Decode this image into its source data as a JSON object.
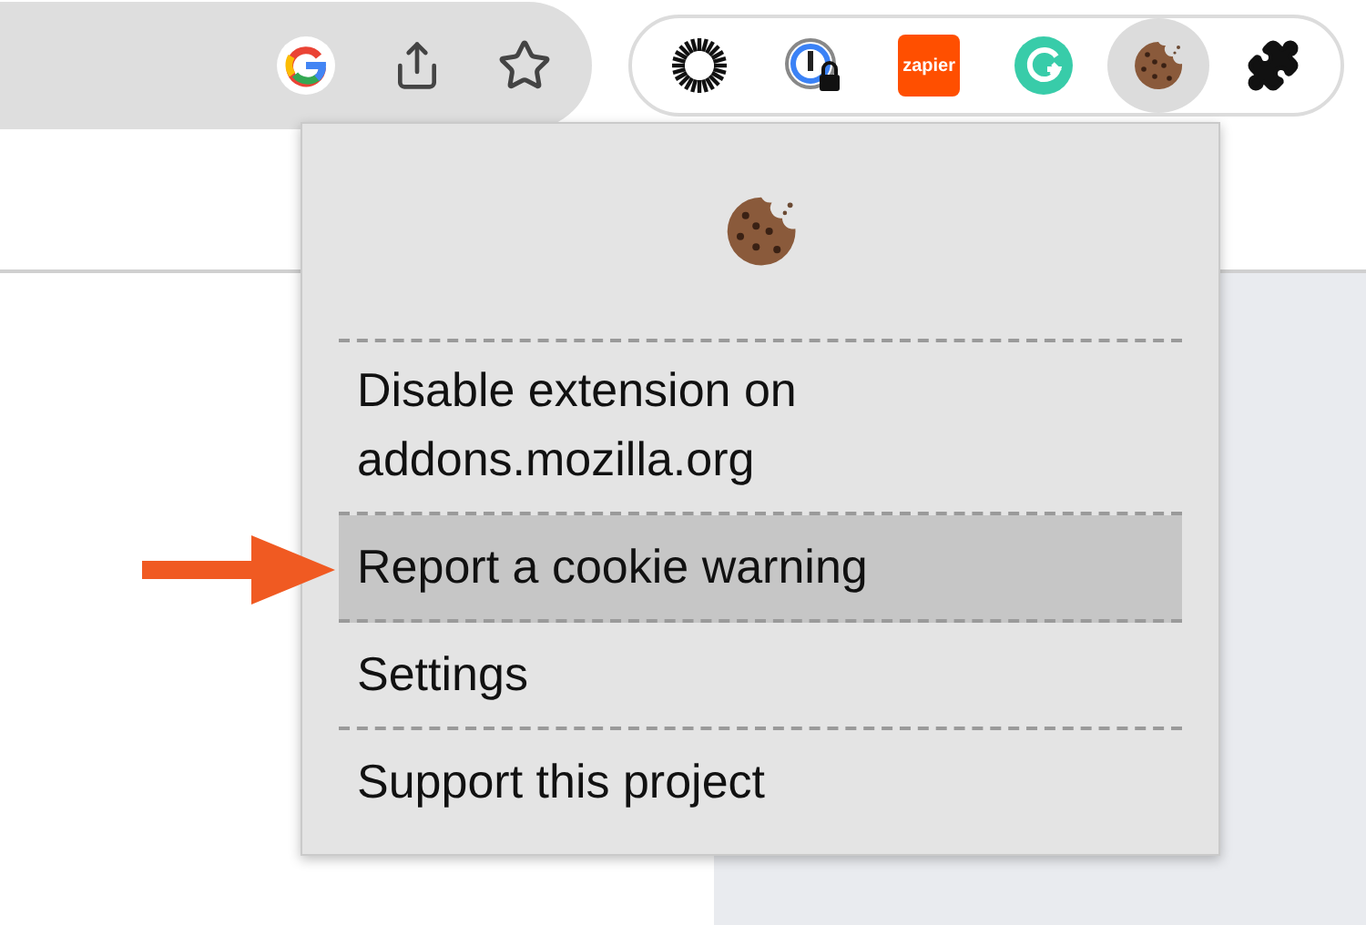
{
  "toolbar": {
    "actions": [
      {
        "kind": "google"
      },
      {
        "kind": "share"
      },
      {
        "kind": "bookmark"
      }
    ]
  },
  "extensions": [
    {
      "kind": "sunburst",
      "selected": false
    },
    {
      "kind": "password",
      "selected": false
    },
    {
      "kind": "zapier",
      "label": "zapier",
      "selected": false
    },
    {
      "kind": "grammar",
      "selected": false
    },
    {
      "kind": "cookie",
      "selected": true
    },
    {
      "kind": "puzzle",
      "selected": false
    }
  ],
  "popup": {
    "items": [
      {
        "label": "Disable extension on addons.mozilla.org",
        "selected": false
      },
      {
        "label": "Report a cookie warning",
        "selected": true
      },
      {
        "label": "Settings",
        "selected": false
      },
      {
        "label": "Support this project",
        "selected": false
      }
    ]
  }
}
